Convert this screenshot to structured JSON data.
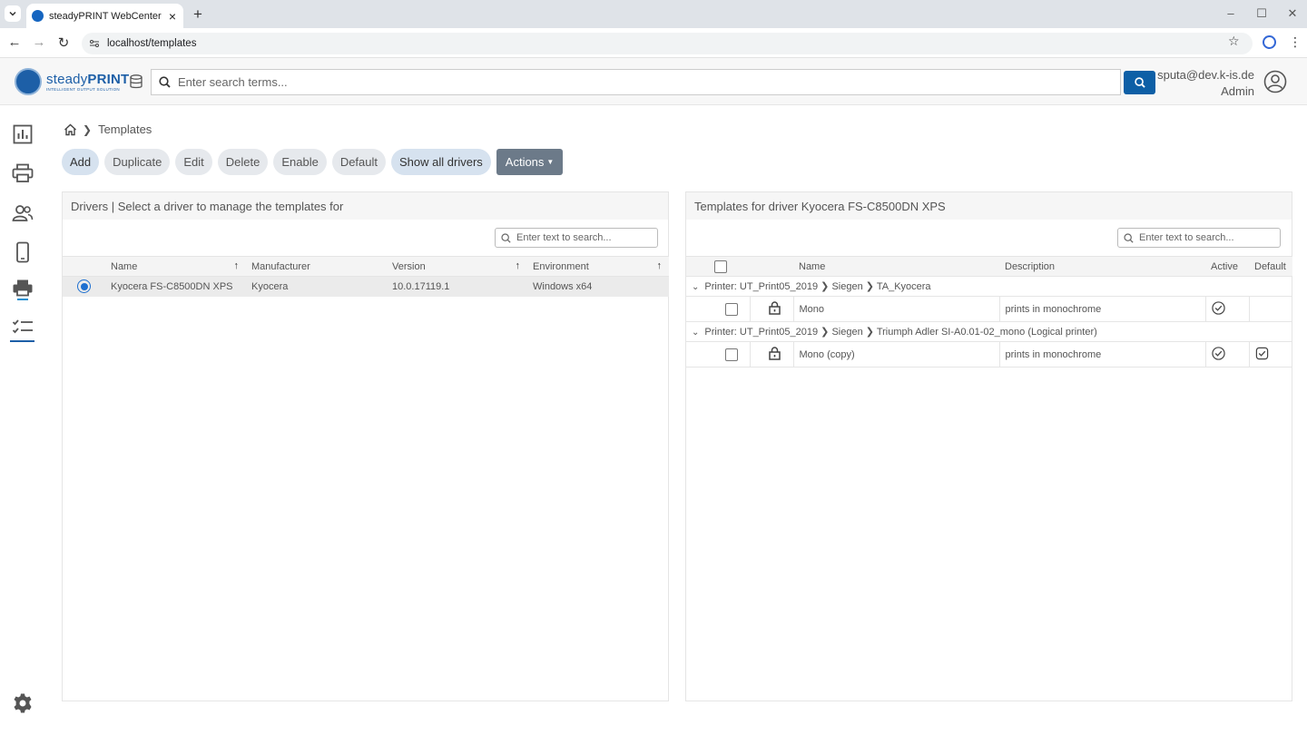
{
  "browser": {
    "tab_title": "steadyPRINT WebCenter",
    "url": "localhost/templates"
  },
  "header": {
    "logo_name_light": "steady",
    "logo_name_bold": "PRINT",
    "logo_tagline": "INTELLIGENT OUTPUT SOLUTION",
    "search_placeholder": "Enter search terms...",
    "user_email": "sputa@dev.k-is.de",
    "user_role": "Admin"
  },
  "sidebar": {
    "items": [
      {
        "icon": "dashboard-chart-icon"
      },
      {
        "icon": "printer-icon"
      },
      {
        "icon": "users-icon"
      },
      {
        "icon": "mobile-icon"
      },
      {
        "icon": "print-server-icon"
      },
      {
        "icon": "checklist-icon",
        "active": true
      }
    ],
    "settings_icon": "gear-icon"
  },
  "breadcrumb": {
    "current": "Templates"
  },
  "toolbar": {
    "add": "Add",
    "duplicate": "Duplicate",
    "edit": "Edit",
    "delete": "Delete",
    "enable": "Enable",
    "default": "Default",
    "show_all_drivers": "Show all drivers",
    "actions": "Actions"
  },
  "drivers_panel": {
    "title": "Drivers | Select a driver to manage the templates for",
    "search_placeholder": "Enter text to search...",
    "columns": [
      "Name",
      "Manufacturer",
      "Version",
      "Environment"
    ],
    "rows": [
      {
        "name": "Kyocera FS-C8500DN XPS",
        "manufacturer": "Kyocera",
        "version": "10.0.17119.1",
        "environment": "Windows x64",
        "selected": true
      }
    ]
  },
  "templates_panel": {
    "title": "Templates for driver Kyocera FS-C8500DN XPS",
    "search_placeholder": "Enter text to search...",
    "columns": [
      "Name",
      "Description",
      "Active",
      "Default"
    ],
    "groups": [
      {
        "label": "Printer: UT_Print05_2019 ❯ Siegen ❯ TA_Kyocera",
        "rows": [
          {
            "name": "Mono",
            "description": "prints in monochrome",
            "active": true,
            "default": false
          }
        ]
      },
      {
        "label": "Printer: UT_Print05_2019 ❯ Siegen ❯ Triumph Adler SI-A0.01-02_mono (Logical printer)",
        "rows": [
          {
            "name": "Mono (copy)",
            "description": "prints in monochrome",
            "active": true,
            "default": true
          }
        ]
      }
    ]
  }
}
